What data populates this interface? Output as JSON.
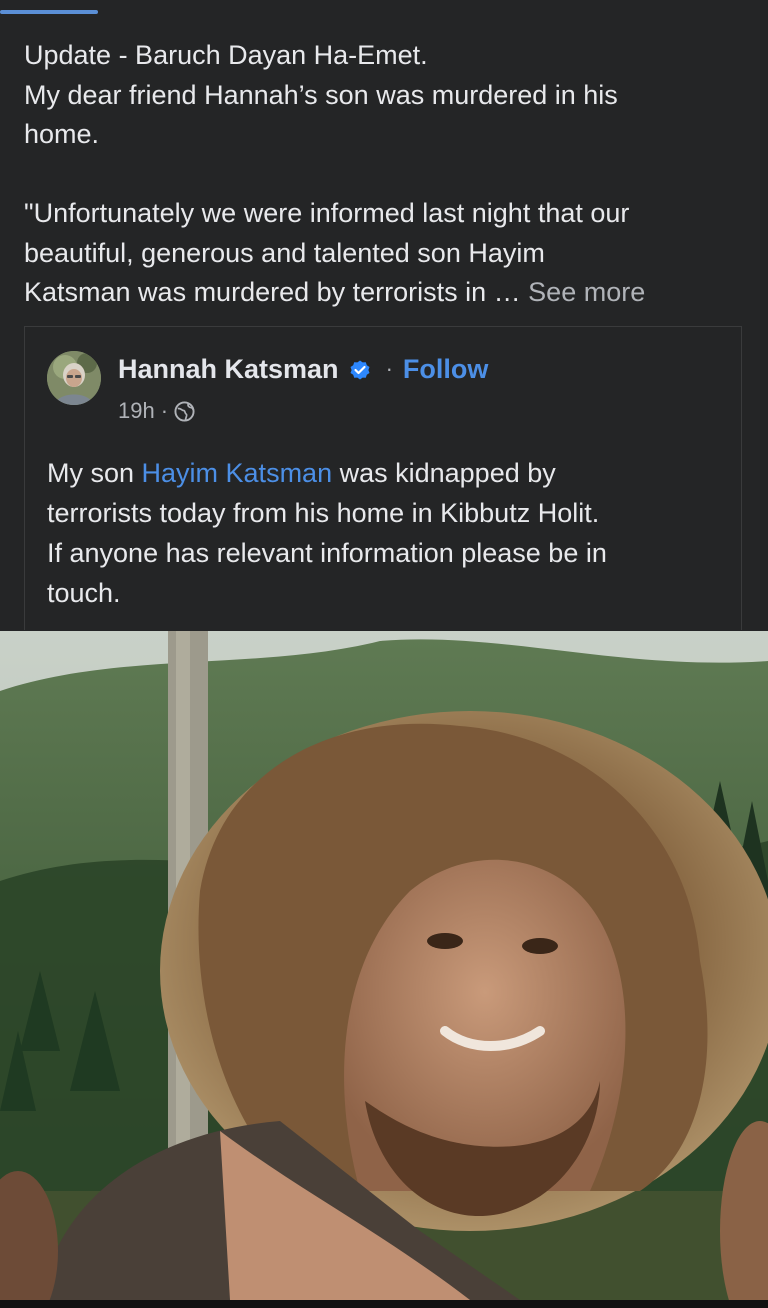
{
  "post": {
    "line1": "Update - Baruch Dayan Ha-Emet.",
    "line2": "My dear friend Hannah’s son was murdered in his",
    "line3": "home.",
    "line4": "\"Unfortunately we were informed last night that our",
    "line5": "beautiful, generous and talented son Hayim",
    "line6": "Katsman was murdered by terrorists in … ",
    "see_more": "See more"
  },
  "shared_post": {
    "author": "Hannah Katsman",
    "separator": "·",
    "follow": "Follow",
    "time": "19h",
    "time_separator": "·",
    "text_before": "My son ",
    "mention": "Hayim Katsman",
    "text_line1_after": " was kidnapped by",
    "text_line2": "terrorists today from his home in Kibbutz Holit.",
    "text_line3": "If anyone has relevant information please be in",
    "text_line4": "touch."
  },
  "colors": {
    "background": "#242526",
    "link_blue": "#4c8fe6",
    "secondary_text": "#b0b3b8",
    "verified_badge": "#2d88ff"
  },
  "icons": {
    "verified": "verified-badge-icon",
    "privacy": "globe-icon"
  }
}
